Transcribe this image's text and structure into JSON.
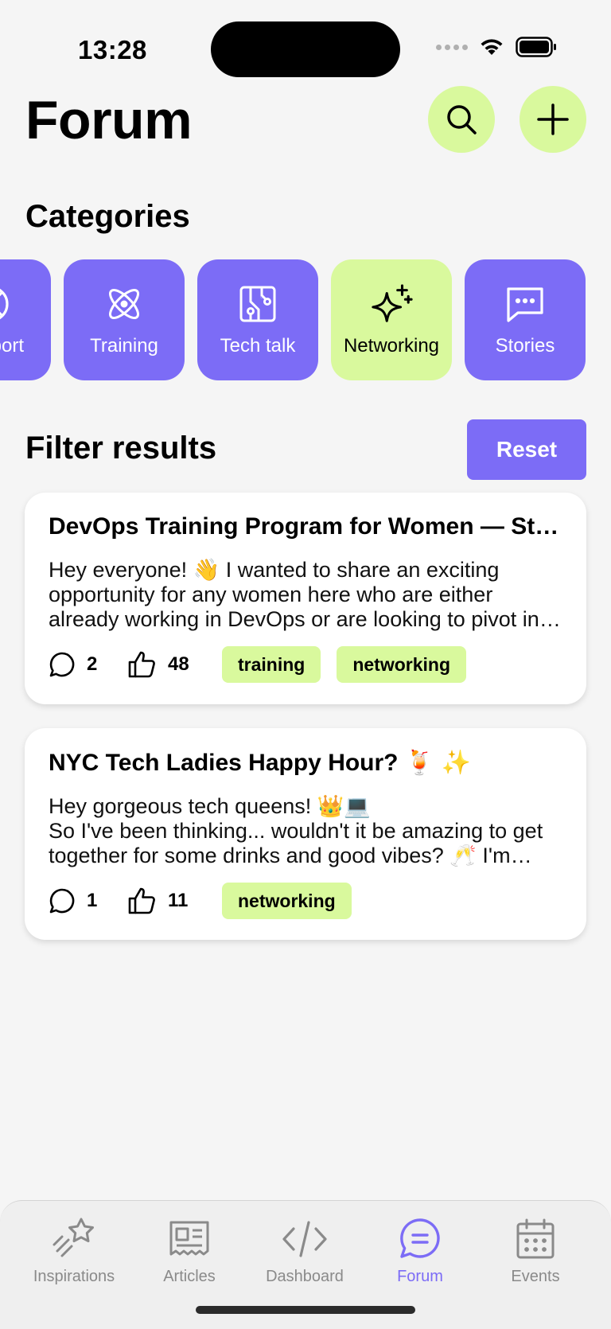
{
  "status": {
    "time": "13:28"
  },
  "header": {
    "title": "Forum"
  },
  "categories": {
    "title": "Categories",
    "items": [
      {
        "label": "Support",
        "icon": "lifebuoy-icon",
        "active": false
      },
      {
        "label": "Training",
        "icon": "atom-icon",
        "active": false
      },
      {
        "label": "Tech talk",
        "icon": "circuit-board-icon",
        "active": false
      },
      {
        "label": "Networking",
        "icon": "sparkles-icon",
        "active": true
      },
      {
        "label": "Stories",
        "icon": "chat-bubble-dots-icon",
        "active": false
      }
    ]
  },
  "filter": {
    "title": "Filter results",
    "reset_label": "Reset"
  },
  "posts": [
    {
      "title": "DevOps Training Program for Women — Starting Soon",
      "body": "Hey everyone! 👋 I wanted to share an exciting opportunity for any women here who are either already working in DevOps or are looking to pivot into it.",
      "comments": "2",
      "likes": "48",
      "tags": [
        "training",
        "networking"
      ]
    },
    {
      "title": "NYC Tech Ladies Happy Hour? 🍹 ✨",
      "body": "Hey gorgeous tech queens! 👑💻\nSo I've been thinking... wouldn't it be amazing to get together for some drinks and good vibes? 🥂  I'm thinking of a casual meetup.",
      "comments": "1",
      "likes": "11",
      "tags": [
        "networking"
      ]
    }
  ],
  "tabs": [
    {
      "label": "Inspirations",
      "icon": "shooting-star-icon",
      "active": false
    },
    {
      "label": "Articles",
      "icon": "newspaper-icon",
      "active": false
    },
    {
      "label": "Dashboard",
      "icon": "code-icon",
      "active": false
    },
    {
      "label": "Forum",
      "icon": "chat-lines-icon",
      "active": true
    },
    {
      "label": "Events",
      "icon": "calendar-icon",
      "active": false
    }
  ],
  "colors": {
    "accent": "#7c6cf6",
    "lime": "#d9f99d",
    "background": "#f5f5f5"
  }
}
